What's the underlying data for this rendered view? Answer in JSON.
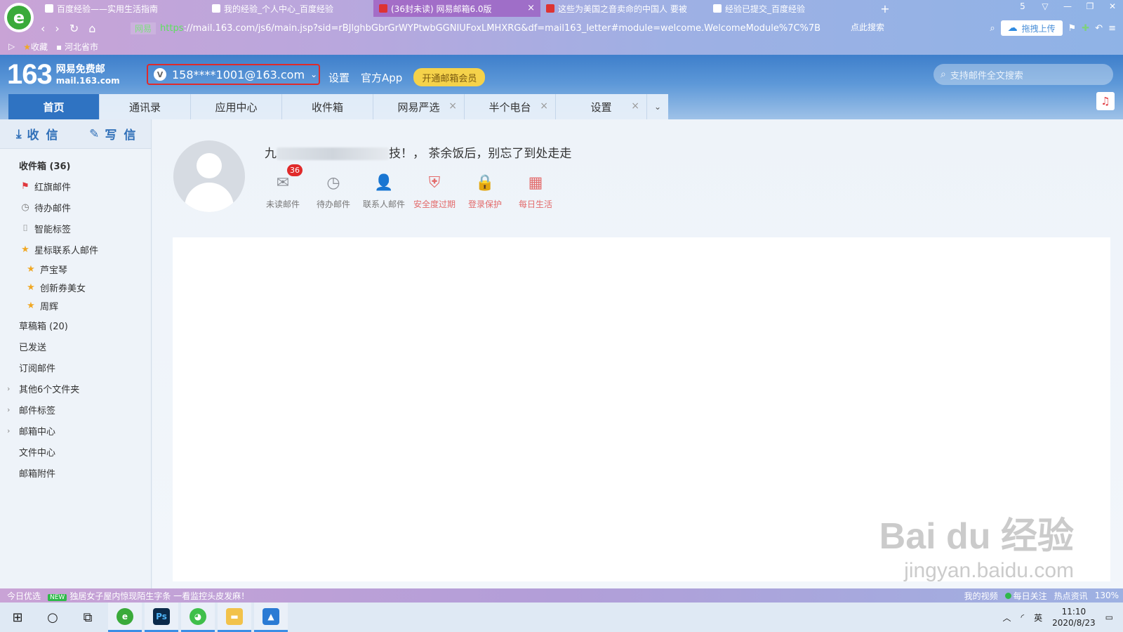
{
  "browser": {
    "tabs": [
      {
        "title": "百度经验——实用生活指南",
        "icon": "baidu-icon"
      },
      {
        "title": "我的经验_个人中心_百度经验",
        "icon": "baidu-icon"
      },
      {
        "title": "(36封未读) 网易邮箱6.0版",
        "icon": "netease-icon",
        "active": true,
        "close": "×"
      },
      {
        "title": "这些为美国之音卖命的中国人 要被",
        "icon": "netease-icon"
      },
      {
        "title": "经验已提交_百度经验",
        "icon": "baidu-icon"
      }
    ],
    "new_tab": "+",
    "tab_count": "5",
    "secure_label": "网易",
    "url_scheme": "https",
    "url_rest": "://mail.163.com/js6/main.jsp?sid=rBJlghbGbrGrWYPtwbGGNIUFoxLMHXRG&df=mail163_letter#module=welcome.WelcomeModule%7C%7B",
    "search_hint": "点此搜索",
    "upload_label": "拖拽上传",
    "bookmarks": [
      "收藏",
      "河北省市"
    ]
  },
  "mail": {
    "logo_num": "163",
    "logo_line1": "网易免费邮",
    "logo_line2": "mail.163.com",
    "account": "158****1001@163.com",
    "account_v": "V",
    "links": [
      "设置",
      "官方App"
    ],
    "vip_label": "开通邮箱会员",
    "search_placeholder": "支持邮件全文搜索",
    "tabs": [
      {
        "label": "首页",
        "active": true
      },
      {
        "label": "通讯录"
      },
      {
        "label": "应用中心"
      },
      {
        "label": "收件箱"
      },
      {
        "label": "网易严选",
        "closable": true
      },
      {
        "label": "半个电台",
        "closable": true
      },
      {
        "label": "设置",
        "closable": true
      }
    ],
    "tab_close": "×"
  },
  "sidebar": {
    "receive": "收 信",
    "compose": "写 信",
    "folders": {
      "inbox": "收件箱 (36)",
      "red_flag": "红旗邮件",
      "todo": "待办邮件",
      "smart_tag": "智能标签",
      "starred_contacts": "星标联系人邮件",
      "contact_1": "芦宝琴",
      "contact_2": "创新券美女",
      "contact_3": "周辉",
      "drafts": "草稿箱 (20)",
      "sent": "已发送",
      "subscriptions": "订阅邮件",
      "other_folders": "其他6个文件夹",
      "mail_tags": "邮件标签",
      "mail_center": "邮箱中心",
      "file_center": "文件中心",
      "attachments": "邮箱附件"
    }
  },
  "main": {
    "greeting_prefix": "九",
    "greeting_suffix": "技！， 茶余饭后，别忘了到处走走",
    "quick": [
      {
        "label": "未读邮件",
        "icon": "mail-icon",
        "badge": "36"
      },
      {
        "label": "待办邮件",
        "icon": "clock-icon"
      },
      {
        "label": "联系人邮件",
        "icon": "contact-star-icon"
      },
      {
        "label": "安全度过期",
        "icon": "shield-icon",
        "alert": true
      },
      {
        "label": "登录保护",
        "icon": "lock-icon",
        "alert": true
      },
      {
        "label": "每日生活",
        "icon": "calendar-icon",
        "alert": true
      }
    ]
  },
  "watermark": {
    "line1": "Bai du 经验",
    "line2": "jingyan.baidu.com"
  },
  "statusbar": {
    "today": "今日优选",
    "news": "独居女子屋内惊现陌生字条 一看监控头皮发麻！",
    "right_items": [
      "我的视频",
      "每日关注",
      "热点资讯"
    ],
    "zoom": "130%"
  },
  "taskbar": {
    "time": "11:10",
    "date": "2020/8/23",
    "ime": "英"
  }
}
